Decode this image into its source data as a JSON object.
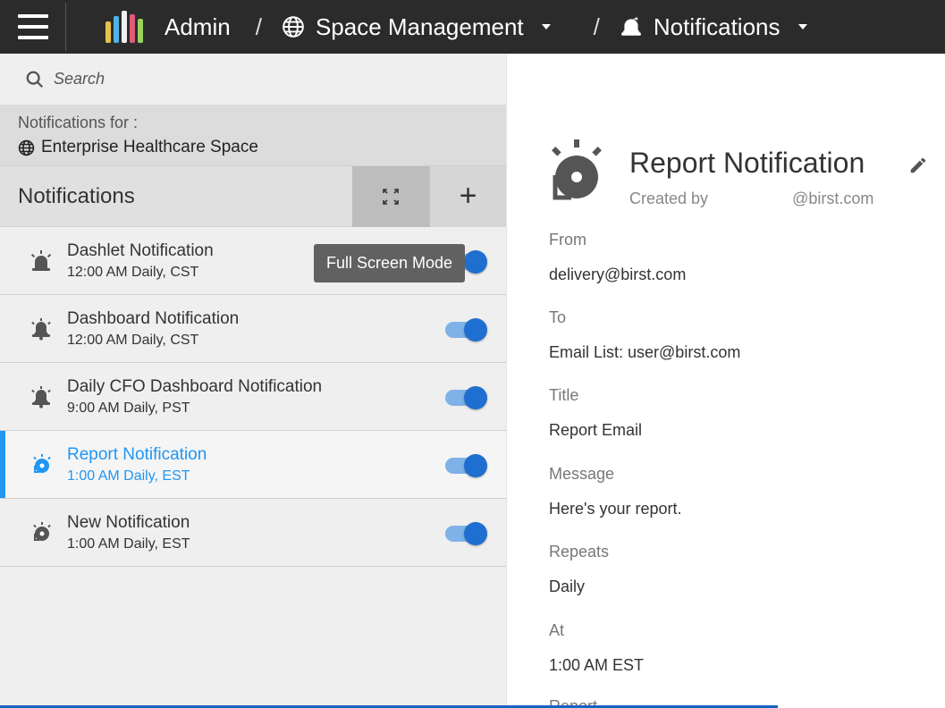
{
  "topbar": {
    "admin": "Admin",
    "sep": "/",
    "space_management": "Space Management",
    "notifications": "Notifications"
  },
  "left": {
    "search_placeholder": "Search",
    "notifications_for_label": "Notifications for :",
    "space_name": "Enterprise Healthcare Space",
    "header_title": "Notifications",
    "add_label": "+",
    "tooltip": "Full Screen Mode",
    "items": [
      {
        "name": "Dashlet Notification",
        "schedule": "12:00 AM Daily, CST",
        "enabled": true
      },
      {
        "name": "Dashboard Notification",
        "schedule": "12:00 AM Daily, CST",
        "enabled": true
      },
      {
        "name": "Daily CFO Dashboard Notification",
        "schedule": "9:00 AM Daily, PST",
        "enabled": true
      },
      {
        "name": "Report Notification",
        "schedule": "1:00 AM Daily, EST",
        "enabled": true
      },
      {
        "name": "New Notification",
        "schedule": "1:00 AM Daily, EST",
        "enabled": true
      }
    ]
  },
  "detail": {
    "title": "Report Notification",
    "created_by_label": "Created by",
    "created_by_email": "@birst.com",
    "from_label": "From",
    "from_value": "delivery@birst.com",
    "to_label": "To",
    "to_value": "Email List: user@birst.com",
    "title_label": "Title",
    "title_value": "Report Email",
    "message_label": "Message",
    "message_value": "Here's your report.",
    "repeats_label": "Repeats",
    "repeats_value": "Daily",
    "at_label": "At",
    "at_value": "1:00 AM EST",
    "report_label": "Report"
  },
  "colors": {
    "accent": "#2196f3",
    "toggle_knob": "#1e6fd0",
    "topbar": "#2b2b2b"
  }
}
